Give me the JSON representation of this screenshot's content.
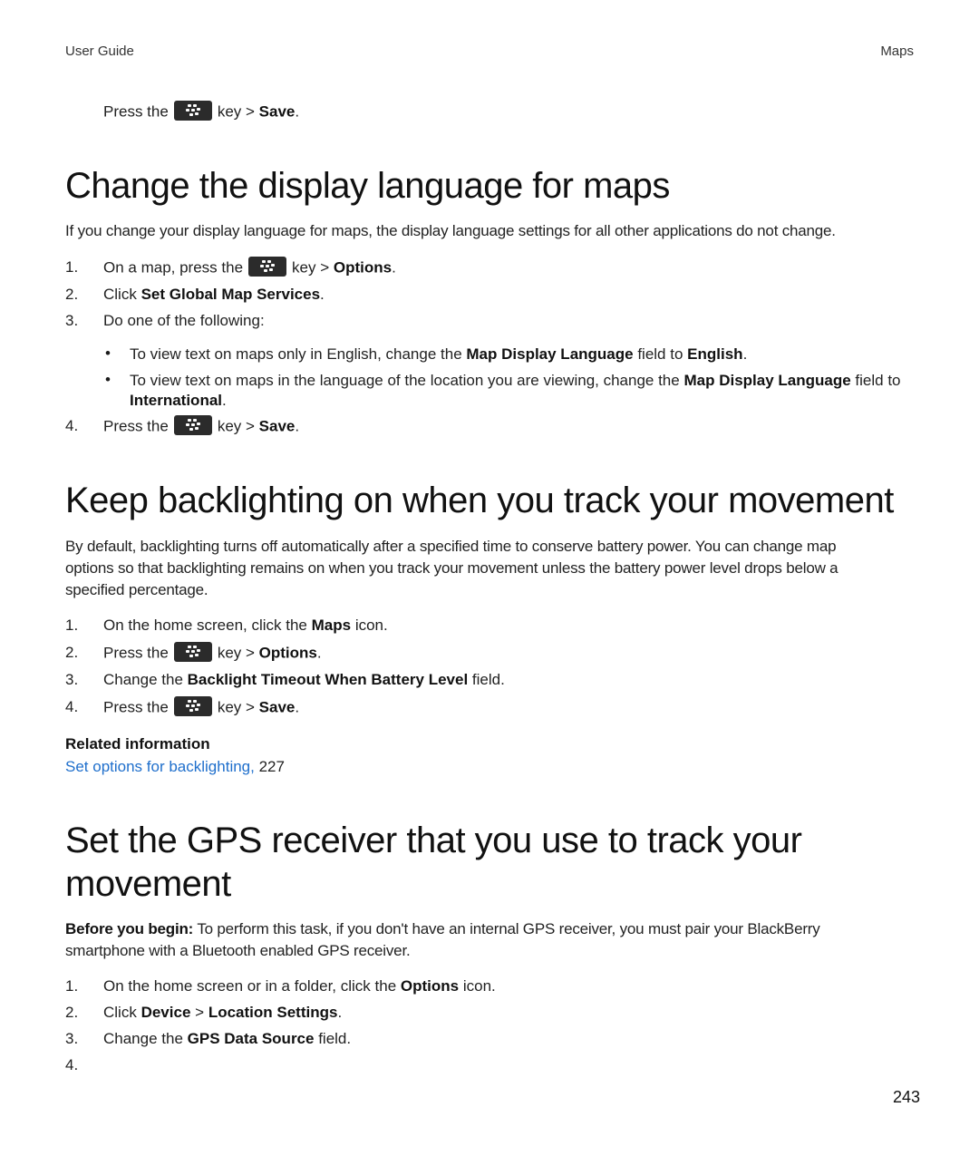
{
  "header": {
    "left": "User Guide",
    "right": "Maps"
  },
  "top_step": {
    "pre": "Press the",
    "post": "key >",
    "bold": "Save",
    "end": "."
  },
  "section1": {
    "title": "Change the display language for maps",
    "intro": "If you change your display language for maps, the display language settings for all other applications do not change.",
    "steps": [
      {
        "num": "1.",
        "pre": "On a map, press the",
        "post": "key >",
        "bold": "Options",
        "end": "."
      },
      {
        "num": "2.",
        "pre": "Click",
        "bold": "Set Global Map Services",
        "end": "."
      },
      {
        "num": "3.",
        "text": "Do one of the following:"
      },
      {
        "num": "4.",
        "pre": "Press the",
        "post": "key >",
        "bold": "Save",
        "end": "."
      }
    ],
    "bullets": [
      {
        "a": "To view text on maps only in English, change the",
        "b1": "Map Display Language",
        "c": "field to",
        "b2": "English",
        "end": "."
      },
      {
        "a": "To view text on maps in the language of the location you are viewing, change the",
        "b1": "Map Display Language",
        "c": "field to",
        "b2": "International",
        "end": "."
      }
    ]
  },
  "section2": {
    "title": "Keep backlighting on when you track your movement",
    "intro": "By default, backlighting turns off automatically after a specified time to conserve battery power. You can change map options so that backlighting remains on when you track your movement unless the battery power level drops below a specified percentage.",
    "steps": [
      {
        "num": "1.",
        "pre": "On the home screen, click the",
        "bold": "Maps",
        "end": " icon."
      },
      {
        "num": "2.",
        "pre": "Press the",
        "post": "key >",
        "bold": "Options",
        "end": "."
      },
      {
        "num": "3.",
        "pre": "Change the",
        "bold": "Backlight Timeout When Battery Level",
        "end": " field."
      },
      {
        "num": "4.",
        "pre": "Press the",
        "post": "key >",
        "bold": "Save",
        "end": "."
      }
    ],
    "related_heading": "Related information",
    "related_link": "Set options for backlighting,",
    "related_page": "227"
  },
  "section3": {
    "title_line1": "Set the GPS receiver that you use to track your",
    "title_line2": "movement",
    "before_label": "Before you begin:",
    "before_text": "To perform this task, if you don't have an internal GPS receiver, you must pair your BlackBerry smartphone with a Bluetooth enabled GPS receiver.",
    "steps": [
      {
        "num": "1.",
        "pre": "On the home screen or in a folder, click the",
        "bold": "Options",
        "end": " icon."
      },
      {
        "num": "2.",
        "pre": "Click",
        "bold": "Device",
        "mid": ">",
        "bold2": "Location Settings",
        "end": "."
      },
      {
        "num": "3.",
        "pre": "Change the",
        "bold": "GPS Data Source",
        "end": " field."
      },
      {
        "num": "4."
      }
    ]
  },
  "footer": {
    "page_number": "243"
  },
  "icons": {
    "menu_key": "blackberry-menu-key-icon"
  }
}
